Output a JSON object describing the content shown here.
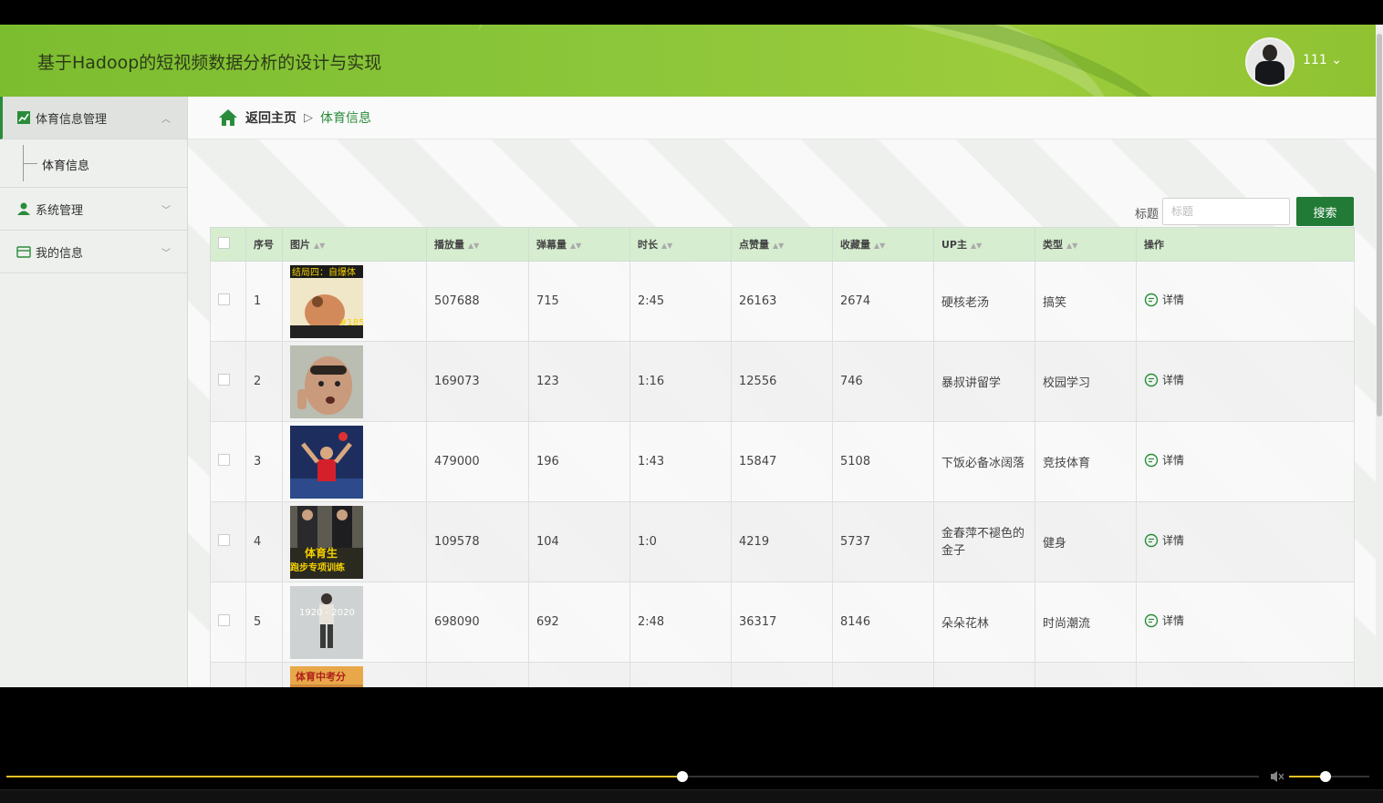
{
  "header": {
    "title": "基于Hadoop的短视频数据分析的设计与实现",
    "user": "111",
    "user_chevron": "⌄"
  },
  "sidebar": {
    "groups": [
      {
        "label": "体育信息管理",
        "chevron": "︿"
      },
      {
        "label": "系统管理",
        "chevron": "﹀"
      },
      {
        "label": "我的信息",
        "chevron": "﹀"
      }
    ],
    "subitems": [
      "体育信息"
    ]
  },
  "breadcrumb": {
    "home": "返回主页",
    "sep": "▷",
    "current": "体育信息"
  },
  "search": {
    "label": "标题",
    "placeholder": "标题",
    "button": "搜索"
  },
  "table": {
    "sort_glyph": "▲▼",
    "columns": [
      "序号",
      "图片",
      "播放量",
      "弹幕量",
      "时长",
      "点赞量",
      "收藏量",
      "UP主",
      "类型",
      "操作"
    ],
    "rows": [
      {
        "no": "1",
        "plays": "507688",
        "danmaku": "715",
        "duration": "2:45",
        "likes": "26163",
        "favs": "2674",
        "up": "硬核老汤",
        "type": "搞笑",
        "action": "详情"
      },
      {
        "no": "2",
        "plays": "169073",
        "danmaku": "123",
        "duration": "1:16",
        "likes": "12556",
        "favs": "746",
        "up": "暴叔讲留学",
        "type": "校园学习",
        "action": "详情"
      },
      {
        "no": "3",
        "plays": "479000",
        "danmaku": "196",
        "duration": "1:43",
        "likes": "15847",
        "favs": "5108",
        "up": "下饭必备冰阔落",
        "type": "竞技体育",
        "action": "详情"
      },
      {
        "no": "4",
        "plays": "109578",
        "danmaku": "104",
        "duration": "1:0",
        "likes": "4219",
        "favs": "5737",
        "up": "金春萍不褪色的金子",
        "type": "健身",
        "action": "详情"
      },
      {
        "no": "5",
        "plays": "698090",
        "danmaku": "692",
        "duration": "2:48",
        "likes": "36317",
        "favs": "8146",
        "up": "朵朵花林",
        "type": "时尚潮流",
        "action": "详情"
      }
    ],
    "thumb_texts": [
      "结局四：自爆体",
      "#185",
      "体育生",
      "跑步专项训练",
      "1920 - 2020",
      "体育中考分"
    ]
  },
  "player": {
    "progress": 0.54,
    "volume": 0.45
  },
  "colors": {
    "accent": "#217a35",
    "header": "#8cc63a",
    "progress": "#e3c020"
  }
}
